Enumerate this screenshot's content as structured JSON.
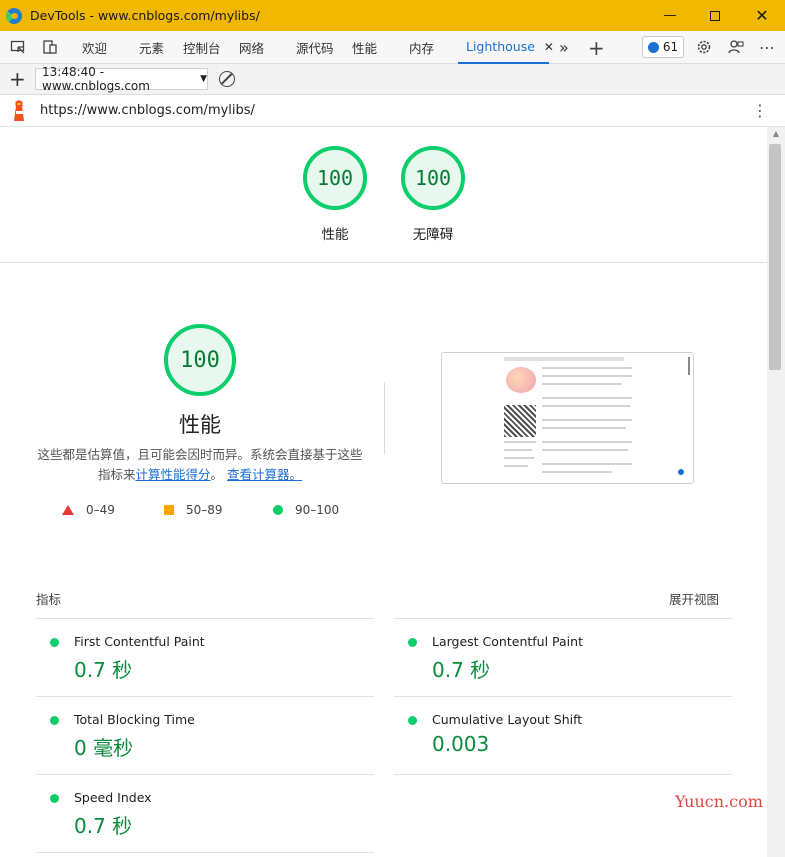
{
  "window": {
    "title": "DevTools - www.cnblogs.com/mylibs/"
  },
  "tabs": {
    "welcome": "欢迎",
    "elements": "元素",
    "console": "控制台",
    "network": "网络",
    "sources": "源代码",
    "performance": "性能",
    "memory": "内存",
    "lighthouse": "Lighthouse",
    "more": "»",
    "issues_count": "61"
  },
  "report": {
    "selected": "13:48:40 - www.cnblogs.com"
  },
  "urlbar": {
    "url": "https://www.cnblogs.com/mylibs/"
  },
  "summary": {
    "gauges": [
      {
        "score": "100",
        "label": "性能"
      },
      {
        "score": "100",
        "label": "无障碍"
      }
    ]
  },
  "performance": {
    "score": "100",
    "title": "性能",
    "desc_prefix": "这些都是估算值，且可能会因时而异。系统会直接基于这些指标来",
    "desc_link1": "计算性能得分",
    "desc_mid": "。",
    "desc_link2": "查看计算器。",
    "legend": [
      {
        "range": "0–49",
        "color": "#e53935"
      },
      {
        "range": "50–89",
        "color": "#ffa400"
      },
      {
        "range": "90–100",
        "color": "#0cce6b"
      }
    ]
  },
  "metrics": {
    "header": "指标",
    "expand": "展开视图",
    "items": [
      {
        "name": "First Contentful Paint",
        "value": "0.7 秒"
      },
      {
        "name": "Largest Contentful Paint",
        "value": "0.7 秒"
      },
      {
        "name": "Total Blocking Time",
        "value": "0 毫秒"
      },
      {
        "name": "Cumulative Layout Shift",
        "value": "0.003"
      },
      {
        "name": "Speed Index",
        "value": "0.7 秒"
      }
    ]
  },
  "watermark": "Yuucn.com",
  "colors": {
    "pass": "#0cce6b",
    "average": "#ffa400",
    "fail": "#e53935",
    "link": "#1a6fd1",
    "titlebar": "#f0b800"
  }
}
